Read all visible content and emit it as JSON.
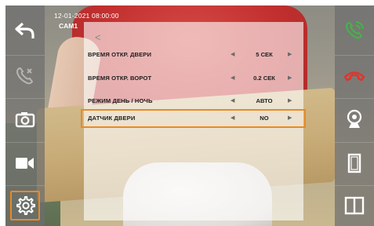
{
  "status": {
    "datetime": "12-01-2021  08:00:00",
    "camera": "CAM1"
  },
  "left_panel": {
    "items": [
      {
        "name": "back-arrow-icon"
      },
      {
        "name": "phone-off-icon"
      },
      {
        "name": "camera-icon"
      },
      {
        "name": "video-camera-icon"
      },
      {
        "name": "settings-gear-icon"
      }
    ]
  },
  "right_panel": {
    "items": [
      {
        "name": "answer-call-icon",
        "color": "#47b14a"
      },
      {
        "name": "hang-up-icon",
        "color": "#e0342b"
      },
      {
        "name": "webcam-icon"
      },
      {
        "name": "door-icon"
      },
      {
        "name": "gate-icon"
      }
    ]
  },
  "menu": {
    "back_symbol": "<",
    "rows": [
      {
        "label": "ВРЕМЯ ОТКР. ДВЕРИ",
        "value": "5 СЕК",
        "left_arrow": "◀",
        "right_arrow": "▶"
      },
      {
        "label": "ВРЕМЯ ОТКР. ВОРОТ",
        "value": "0.2 СЕК",
        "left_arrow": "◀",
        "right_arrow": "▶"
      },
      {
        "label": "РЕЖИМ ДЕНЬ / НОЧЬ",
        "value": "АВТО",
        "left_arrow": "◀",
        "right_arrow": "▶"
      },
      {
        "label": "ДАТЧИК ДВЕРИ",
        "value": "NO",
        "left_arrow": "◀",
        "right_arrow": "▶",
        "selected": true
      }
    ]
  },
  "colors": {
    "highlight": "#e98a25",
    "accept": "#47b14a",
    "decline": "#e0342b"
  }
}
